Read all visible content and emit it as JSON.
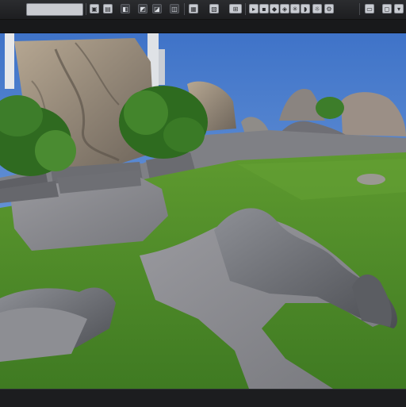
{
  "app": {
    "toolbar_icons": [
      "project-icon",
      "save-icon",
      "open-icon",
      "import-icon",
      "export-icon",
      "camera-icon",
      "render-icon",
      "material-icon",
      "select-icon",
      "move-icon",
      "rotate-icon",
      "scale-icon",
      "paint-icon",
      "sculpt-icon",
      "grass-icon",
      "rock-icon",
      "light-icon",
      "settings-icon",
      "layout-icon",
      "maximize-icon"
    ],
    "viewport": {
      "scene_icons": [
        "sky",
        "rock-wall",
        "shrub",
        "grass-lawn",
        "stone-path",
        "rock-outcrop"
      ]
    },
    "colors": {
      "sky": "#4f80d3",
      "grass": "#4f8a2b",
      "stone": "#8b8b8f",
      "rock": "#6c6f73",
      "shrub": "#2f6a20",
      "chrome": "#1f2022"
    }
  }
}
